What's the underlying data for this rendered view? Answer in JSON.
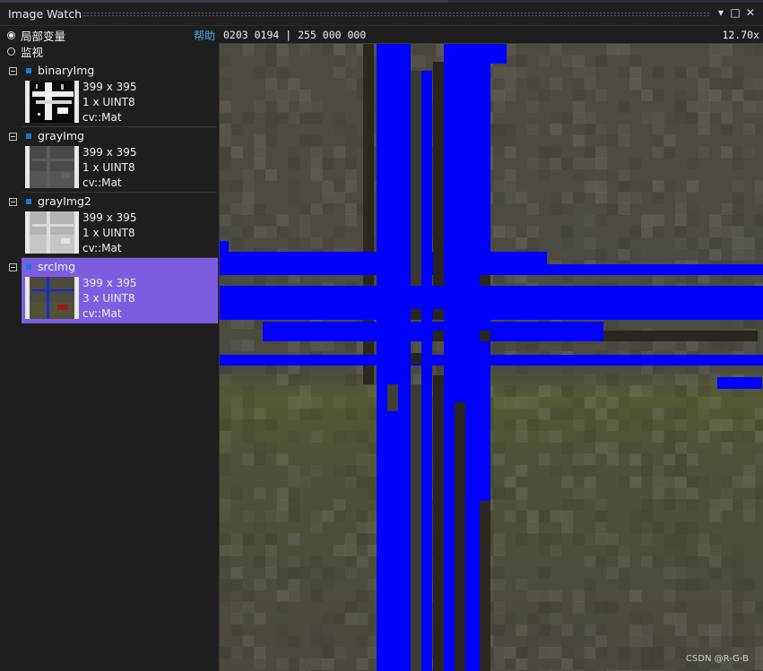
{
  "window": {
    "title": "Image Watch",
    "dropdown_glyph": "▾",
    "maximize_glyph": "□",
    "close_glyph": "✕"
  },
  "scope": {
    "options": [
      {
        "label": "局部变量",
        "selected": true
      },
      {
        "label": "监视",
        "selected": false
      }
    ],
    "help_label": "帮助"
  },
  "variables": [
    {
      "name": "binaryImg",
      "size": "399 x 395",
      "channels": "1 x UINT8",
      "type": "cv::Mat",
      "selected": false,
      "thumb": "binary"
    },
    {
      "name": "grayImg",
      "size": "399 x 395",
      "channels": "1 x UINT8",
      "type": "cv::Mat",
      "selected": false,
      "thumb": "gray"
    },
    {
      "name": "grayImg2",
      "size": "399 x 395",
      "channels": "1 x UINT8",
      "type": "cv::Mat",
      "selected": false,
      "thumb": "gray2"
    },
    {
      "name": "srcImg",
      "size": "399 x 395",
      "channels": "3 x UINT8",
      "type": "cv::Mat",
      "selected": true,
      "thumb": "src"
    }
  ],
  "status": {
    "pixel_readout": "0203 0194 | 255 000 000",
    "zoom": "12.70x"
  },
  "viewer": {
    "overlay_color": "#0000ff",
    "watermark": "CSDN @R-G-B"
  },
  "icons": {
    "collapse": "collapse-minus-icon",
    "color_square": "variable-square-icon"
  }
}
